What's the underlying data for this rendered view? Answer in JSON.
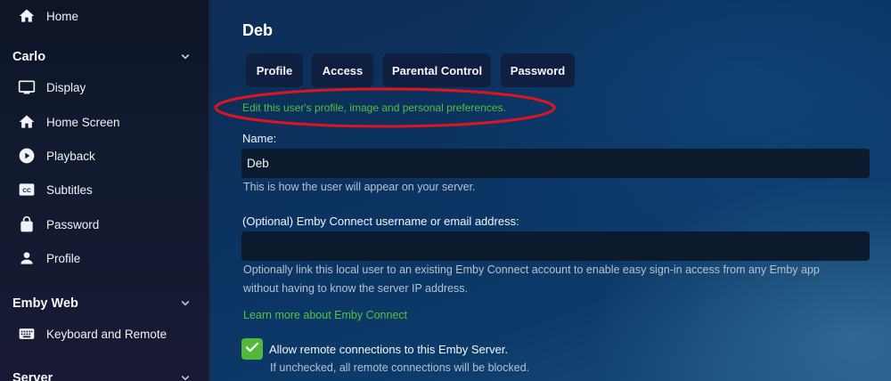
{
  "sidebar": {
    "home": {
      "label": "Home",
      "icon": "home-icon"
    },
    "section_user": {
      "label": "Carlo"
    },
    "items": [
      {
        "label": "Display",
        "icon": "monitor-icon"
      },
      {
        "label": "Home Screen",
        "icon": "home-icon"
      },
      {
        "label": "Playback",
        "icon": "play-circle-icon"
      },
      {
        "label": "Subtitles",
        "icon": "closed-captions-icon"
      },
      {
        "label": "Password",
        "icon": "lock-icon"
      },
      {
        "label": "Profile",
        "icon": "person-icon"
      }
    ],
    "section_web": {
      "label": "Emby Web"
    },
    "web_items": [
      {
        "label": "Keyboard and Remote",
        "icon": "keyboard-icon"
      }
    ],
    "section_server": {
      "label": "Server"
    }
  },
  "main": {
    "title": "Deb",
    "tabs": [
      {
        "label": "Profile"
      },
      {
        "label": "Access"
      },
      {
        "label": "Parental Control"
      },
      {
        "label": "Password"
      }
    ],
    "description": "Edit this user's profile, image and personal preferences.",
    "name_field": {
      "label": "Name:",
      "value": "Deb",
      "help": "This is how the user will appear on your server."
    },
    "connect_field": {
      "label": "(Optional) Emby Connect username or email address:",
      "value": "",
      "help_line1": "Optionally link this local user to an existing Emby Connect account to enable easy sign-in access from any Emby app",
      "help_line2": "without having to know the server IP address.",
      "link": "Learn more about Emby Connect"
    },
    "remote_checkbox": {
      "checked": true,
      "label": "Allow remote connections to this Emby Server.",
      "help": "If unchecked, all remote connections will be blocked."
    }
  },
  "colors": {
    "accent_green": "#52b83b",
    "annotation_red": "#e0141e",
    "tab_bg": "#0e1f40",
    "input_bg": "#0b1a2c"
  }
}
